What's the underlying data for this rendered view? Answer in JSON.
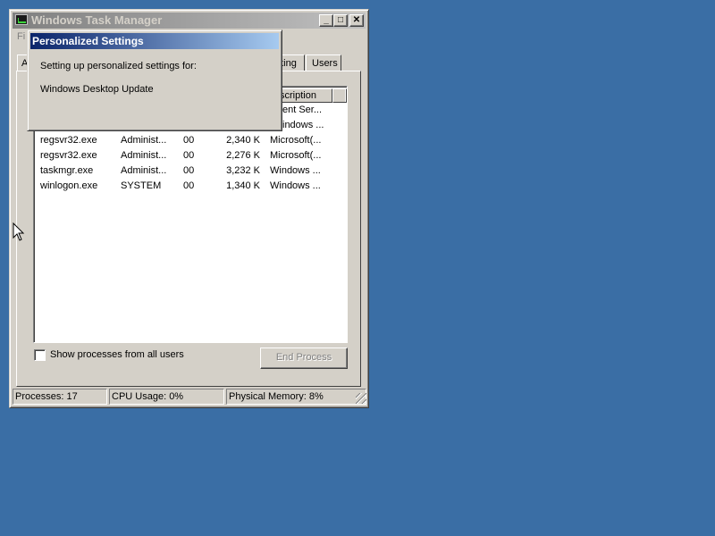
{
  "window": {
    "title": "Windows Task Manager",
    "menu_file": "Fi",
    "minimize_glyph": "_",
    "maximize_glyph": "□",
    "close_glyph": "✕"
  },
  "tabs": {
    "first_partial": "A",
    "networking_partial": "rking",
    "users": "Users"
  },
  "columns": {
    "description_partial": "scription"
  },
  "processes": [
    {
      "name": "",
      "user": "",
      "cpu": "",
      "mem": "",
      "desc": "ent Ser..."
    },
    {
      "name": "",
      "user": "",
      "cpu": "",
      "mem": "",
      "desc": "indows ..."
    },
    {
      "name": "regsvr32.exe",
      "user": "Administ...",
      "cpu": "00",
      "mem": "2,340 K",
      "desc": "Microsoft(..."
    },
    {
      "name": "regsvr32.exe",
      "user": "Administ...",
      "cpu": "00",
      "mem": "2,276 K",
      "desc": "Microsoft(..."
    },
    {
      "name": "taskmgr.exe",
      "user": "Administ...",
      "cpu": "00",
      "mem": "3,232 K",
      "desc": "Windows ..."
    },
    {
      "name": "winlogon.exe",
      "user": "SYSTEM",
      "cpu": "00",
      "mem": "1,340 K",
      "desc": "Windows ..."
    }
  ],
  "controls": {
    "show_all_label": "Show processes from all users",
    "show_all_checked": false,
    "end_process_label": "End Process"
  },
  "status": {
    "processes": "Processes: 17",
    "cpu": "CPU Usage: 0%",
    "memory": "Physical Memory: 8%"
  },
  "dialog": {
    "title": "Personalized Settings",
    "line1": "Setting up personalized settings for:",
    "line2": "Windows Desktop Update"
  }
}
